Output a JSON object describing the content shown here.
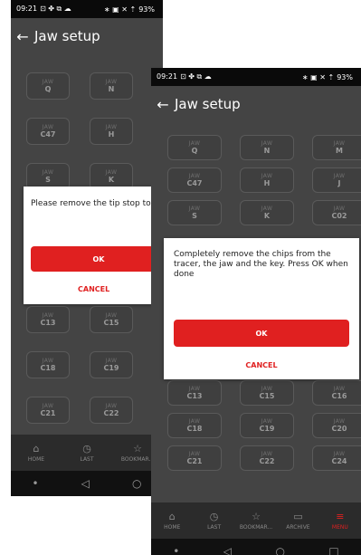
{
  "status": {
    "time": "09:21",
    "battery": "93%"
  },
  "appbar": {
    "title": "Jaw setup"
  },
  "jaw_label": "JAW",
  "back_screen": {
    "jaws": [
      "Q",
      "N",
      "C47",
      "H",
      "S",
      "K",
      "C13",
      "C15",
      "C18",
      "C19",
      "C21",
      "C22"
    ],
    "dialog": {
      "message": "Please remove the tip stop to",
      "ok": "OK",
      "cancel": "CANCEL"
    }
  },
  "front_screen": {
    "jaws": [
      "Q",
      "N",
      "M",
      "C47",
      "H",
      "J",
      "S",
      "K",
      "C02",
      "C13",
      "C15",
      "C16",
      "C18",
      "C19",
      "C20",
      "C21",
      "C22",
      "C24"
    ],
    "dialog": {
      "message": "Completely remove the chips from the tracer, the jaw and the key. Press OK when done",
      "ok": "OK",
      "cancel": "CANCEL"
    }
  },
  "bottom_nav": {
    "home": "HOME",
    "last": "LAST",
    "bookmarks": "BOOKMAR...",
    "archive": "ARCHIVE",
    "menu": "MENU"
  },
  "accent_color": "#e02020"
}
